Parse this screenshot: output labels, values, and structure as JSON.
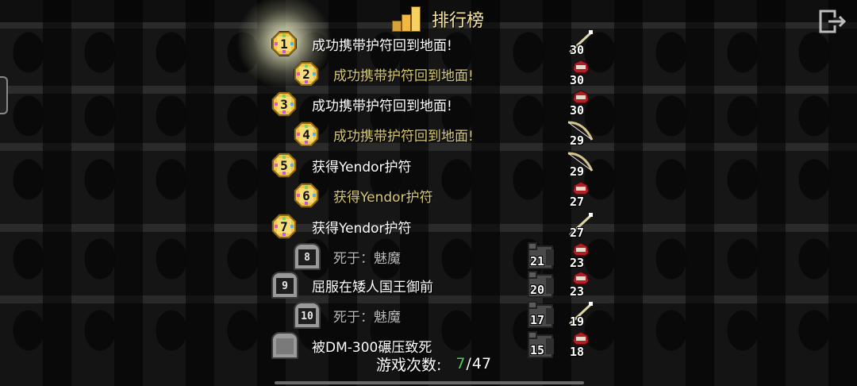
{
  "header": {
    "title": "排行榜",
    "icons": {
      "title": "bar-chart-icon",
      "exit": "exit-icon"
    }
  },
  "colors": {
    "won_text": "#ffffff",
    "won_text_alt": "#d8c870",
    "lost_text": "#b8b8b8",
    "won_count": "#4bd34b",
    "badge_gold": "#f3c34a"
  },
  "records": [
    {
      "rank": "1",
      "description": "成功携带护符回到地面!",
      "status": "won",
      "class_icon": "staff-icon",
      "level": "30",
      "depth": ""
    },
    {
      "rank": "2",
      "description": "成功携带护符回到地面!",
      "status": "won",
      "class_icon": "rogue-hood-icon",
      "level": "30",
      "depth": ""
    },
    {
      "rank": "3",
      "description": "成功携带护符回到地面!",
      "status": "won",
      "class_icon": "rogue-hood-icon",
      "level": "30",
      "depth": ""
    },
    {
      "rank": "4",
      "description": "成功携带护符回到地面!",
      "status": "won",
      "class_icon": "bow-icon",
      "level": "29",
      "depth": ""
    },
    {
      "rank": "5",
      "description": "获得Yendor护符",
      "status": "won",
      "class_icon": "bow-icon",
      "level": "29",
      "depth": ""
    },
    {
      "rank": "6",
      "description": "获得Yendor护符",
      "status": "won",
      "class_icon": "rogue-hood-icon",
      "level": "27",
      "depth": ""
    },
    {
      "rank": "7",
      "description": "获得Yendor护符",
      "status": "won",
      "class_icon": "staff-icon",
      "level": "27",
      "depth": ""
    },
    {
      "rank": "8",
      "description": "死于：魅魔",
      "status": "dead",
      "class_icon": "rogue-hood-icon",
      "level": "23",
      "depth": "21"
    },
    {
      "rank": "9",
      "description": "屈服在矮人国王御前",
      "status": "dead",
      "class_icon": "rogue-hood-icon",
      "level": "23",
      "depth": "20"
    },
    {
      "rank": "10",
      "description": "死于：魅魔",
      "status": "dead",
      "class_icon": "staff-icon",
      "level": "19",
      "depth": "17"
    },
    {
      "rank": "",
      "description": "被DM-300碾压致死",
      "status": "dead",
      "class_icon": "rogue-hood-icon",
      "level": "18",
      "depth": "15"
    }
  ],
  "footer": {
    "games_label": "游戏次数:",
    "won": "7",
    "separator": "/",
    "total": "47"
  }
}
